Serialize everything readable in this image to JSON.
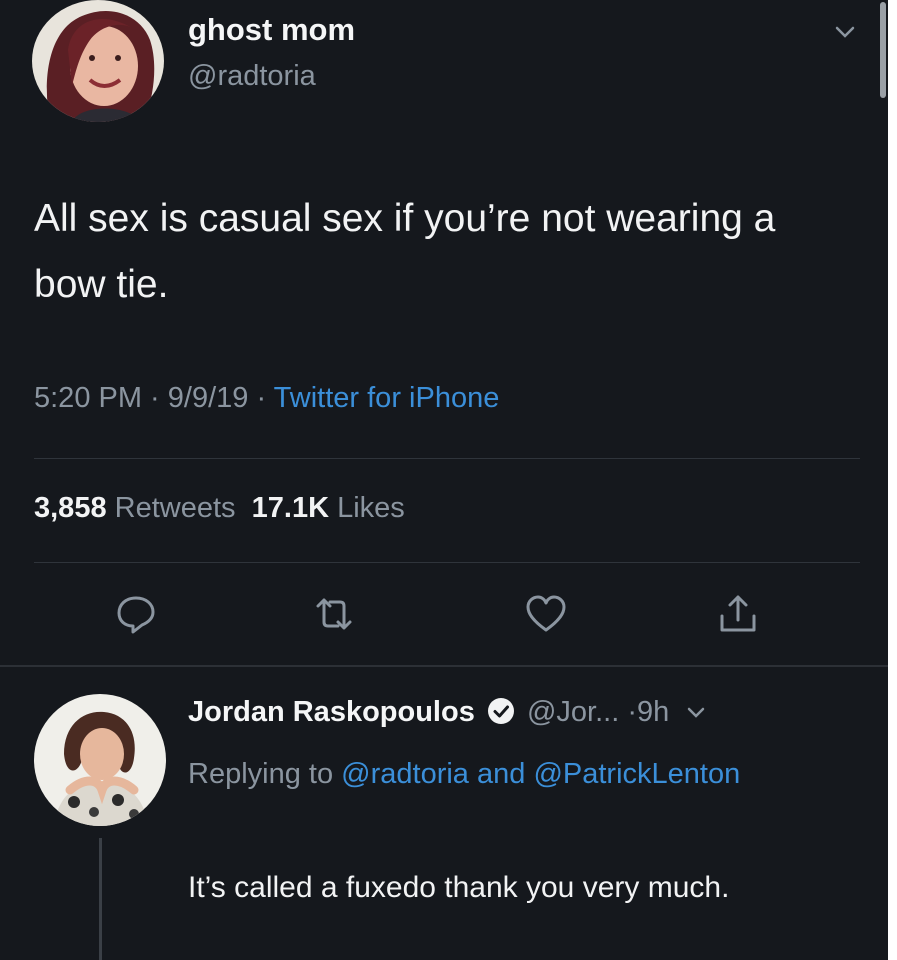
{
  "tweet": {
    "display_name": "ghost mom",
    "handle": "@radtoria",
    "text": "All sex is casual sex if you’re not wearing a bow tie.",
    "time": "5:20 PM",
    "date": "9/9/19",
    "separator": " · ",
    "source": "Twitter for iPhone",
    "retweets_count": "3,858",
    "retweets_label": "Retweets",
    "likes_count": "17.1K",
    "likes_label": "Likes"
  },
  "icons": {
    "menu": "chevron-down-icon",
    "reply": "reply-icon",
    "retweet": "retweet-icon",
    "like": "heart-icon",
    "share": "share-icon",
    "verified": "verified-badge-icon"
  },
  "reply": {
    "display_name": "Jordan Raskopoulos",
    "handle": "@Jor...",
    "age": "·9h",
    "replying_prefix": "Replying to",
    "mention_1": "@radtoria",
    "conjunction": "and",
    "mention_2": "@PatrickLenton",
    "text": "It’s called a fuxedo thank you very much."
  },
  "colors": {
    "background": "#15181d",
    "link": "#3b8fd9",
    "muted": "#8b95a0",
    "text": "#f2f3f4"
  }
}
